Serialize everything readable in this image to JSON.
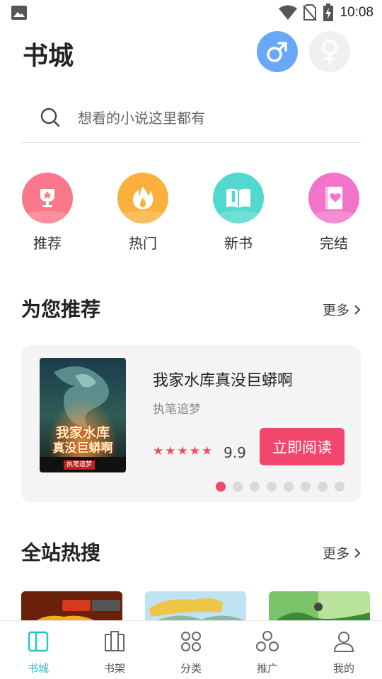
{
  "status_bar": {
    "time": "10:08"
  },
  "header": {
    "title": "书城",
    "male_icon": "male-symbol-icon",
    "female_icon": "female-symbol-icon"
  },
  "search": {
    "placeholder": "想看的小说这里都有"
  },
  "categories": [
    {
      "label": "推荐",
      "icon": "trophy-icon",
      "color": "#f9788a"
    },
    {
      "label": "热门",
      "icon": "flame-icon",
      "color": "#fbb03b"
    },
    {
      "label": "新书",
      "icon": "open-book-icon",
      "color": "#52d8cf"
    },
    {
      "label": "完结",
      "icon": "heart-book-icon",
      "color": "#f274c8"
    }
  ],
  "recommend": {
    "title": "为您推荐",
    "more": "更多",
    "book": {
      "title": "我家水库真没巨蟒啊",
      "author": "执笔追梦",
      "rating": "9.9",
      "star_count": 5,
      "read_button": "立即阅读",
      "cover_text": [
        "我家水库",
        "真没巨蟒啊"
      ],
      "cover_author": "执笔追梦"
    },
    "carousel": {
      "pages": 8,
      "active": 0
    }
  },
  "hot_search": {
    "title": "全站热搜",
    "more": "更多"
  },
  "bottom_nav": [
    {
      "label": "书城",
      "icon": "bookstore-icon",
      "active": true
    },
    {
      "label": "书架",
      "icon": "bookshelf-icon",
      "active": false
    },
    {
      "label": "分类",
      "icon": "category-icon",
      "active": false
    },
    {
      "label": "推广",
      "icon": "share-icon",
      "active": false
    },
    {
      "label": "我的",
      "icon": "profile-icon",
      "active": false
    }
  ],
  "colors": {
    "accent": "#f2466c",
    "nav_active": "#27c2c2",
    "male": "#6aa8f7"
  }
}
